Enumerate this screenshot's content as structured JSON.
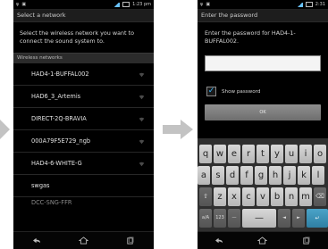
{
  "phone1": {
    "status_time": "1:23 pm",
    "title": "Select a network",
    "description": "Select the wireless network you want to connect the sound system to.",
    "section_header": "Wireless networks",
    "networks": [
      {
        "ssid": "HAD4-1-BUFFAL002"
      },
      {
        "ssid": "HAD6_3_Artemis"
      },
      {
        "ssid": "DIRECT-2Q-BRAVIA"
      },
      {
        "ssid": "000A79F5E729_ngb"
      },
      {
        "ssid": "HAD4-6-WHITE-G"
      },
      {
        "ssid": "swgas"
      },
      {
        "ssid": "DCC-SNG-FFR"
      }
    ]
  },
  "phone2": {
    "status_time": "2:31",
    "title": "Enter the password",
    "prompt": "Enter the password for HAD4-1-BUFFAL002.",
    "password_value": "",
    "show_password_label": "Show password",
    "show_password_checked": true,
    "ok_label": "OK",
    "keyboard": {
      "row1": [
        "q",
        "w",
        "e",
        "r",
        "t",
        "y",
        "u",
        "i",
        "o"
      ],
      "row2": [
        "a",
        "s",
        "d",
        "f",
        "g",
        "h",
        "j",
        "k",
        "l"
      ],
      "row3": [
        "z",
        "x",
        "c",
        "v",
        "b",
        "n",
        "m"
      ],
      "row4": [
        "a/A",
        "123",
        "—",
        "—",
        "◄",
        "►"
      ]
    }
  },
  "colors": {
    "accent": "#3ab8ff",
    "arrow": "#c3c3c3"
  }
}
